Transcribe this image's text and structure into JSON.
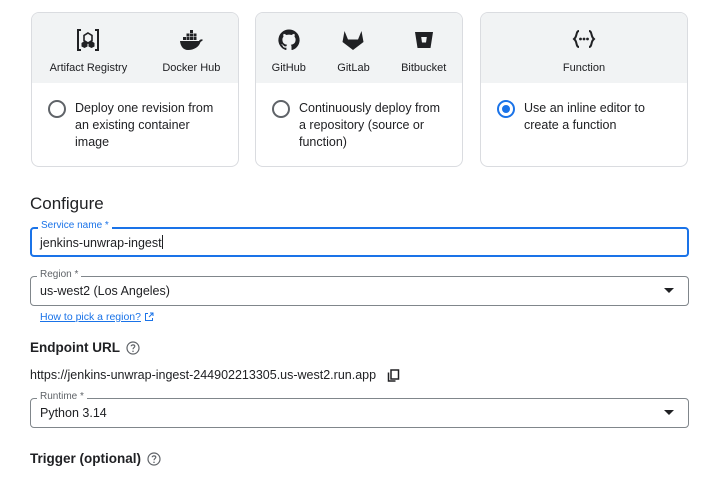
{
  "source_cards": [
    {
      "sources": [
        {
          "icon": "artifact-registry-icon",
          "label": "Artifact Registry"
        },
        {
          "icon": "docker-hub-icon",
          "label": "Docker Hub"
        }
      ],
      "option_text": "Deploy one revision from an existing container image",
      "checked": false
    },
    {
      "sources": [
        {
          "icon": "github-icon",
          "label": "GitHub"
        },
        {
          "icon": "gitlab-icon",
          "label": "GitLab"
        },
        {
          "icon": "bitbucket-icon",
          "label": "Bitbucket"
        }
      ],
      "option_text": "Continuously deploy from a repository (source or function)",
      "checked": false
    },
    {
      "sources": [
        {
          "icon": "function-icon",
          "label": "Function"
        }
      ],
      "option_text": "Use an inline editor to create a function",
      "checked": true
    }
  ],
  "configure": {
    "title": "Configure",
    "service_name": {
      "label": "Service name *",
      "value": "jenkins-unwrap-ingest"
    },
    "region": {
      "label": "Region *",
      "value": "us-west2 (Los Angeles)"
    },
    "region_help_link": "How to pick a region?",
    "endpoint": {
      "title": "Endpoint URL",
      "url": "https://jenkins-unwrap-ingest-244902213305.us-west2.run.app"
    },
    "runtime": {
      "label": "Runtime *",
      "value": "Python 3.14"
    },
    "trigger_title": "Trigger (optional)"
  },
  "colors": {
    "accent": "#1a73e8",
    "card_header_bg": "#f1f3f4",
    "border": "#dadce0"
  }
}
